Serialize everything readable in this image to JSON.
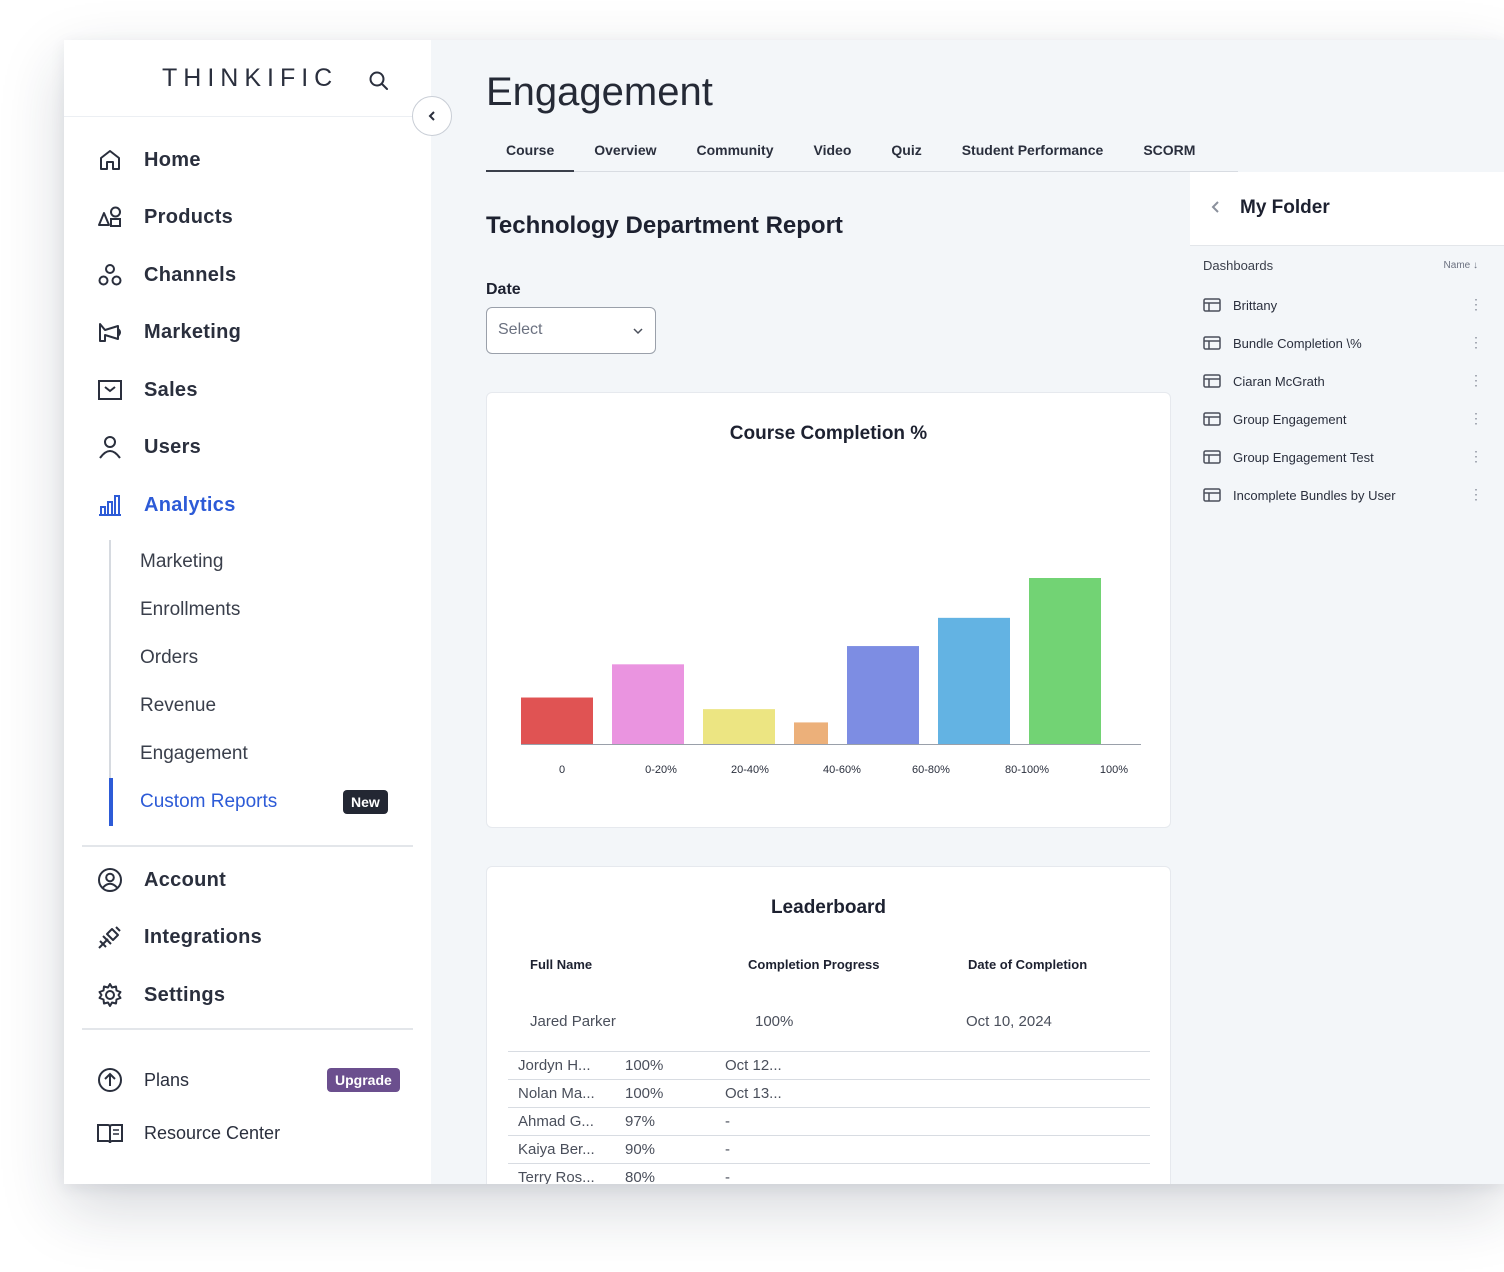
{
  "sidebar": {
    "logo": "THINKIFIC",
    "nav": [
      {
        "label": "Home",
        "icon": "home-icon"
      },
      {
        "label": "Products",
        "icon": "shapes-icon"
      },
      {
        "label": "Channels",
        "icon": "channels-icon"
      },
      {
        "label": "Marketing",
        "icon": "megaphone-icon"
      },
      {
        "label": "Sales",
        "icon": "inbox-icon"
      },
      {
        "label": "Users",
        "icon": "user-icon"
      },
      {
        "label": "Analytics",
        "icon": "bar-chart-icon"
      }
    ],
    "analytics_sub": [
      "Marketing",
      "Enrollments",
      "Orders",
      "Revenue",
      "Engagement",
      "Custom Reports"
    ],
    "new_badge": "New",
    "nav2": [
      {
        "label": "Account",
        "icon": "account-icon"
      },
      {
        "label": "Integrations",
        "icon": "plug-icon"
      },
      {
        "label": "Settings",
        "icon": "gear-icon"
      }
    ],
    "plans": "Plans",
    "upgrade_badge": "Upgrade",
    "resource_center": "Resource Center"
  },
  "main": {
    "title": "Engagement",
    "tabs": [
      "Course",
      "Overview",
      "Community",
      "Video",
      "Quiz",
      "Student Performance",
      "SCORM"
    ],
    "active_tab": "Course",
    "report_title": "Technology Department Report",
    "date_label": "Date",
    "date_select": "Select"
  },
  "chart_data": {
    "type": "bar",
    "title": "Course Completion %",
    "categories": [
      "0",
      "0-20%",
      "20-40%",
      "40-60%",
      "60-80%",
      "80-100%",
      "100%"
    ],
    "values": [
      28,
      48,
      21,
      13,
      59,
      76,
      100
    ],
    "colors": [
      "#e05353",
      "#ea94e0",
      "#ece582",
      "#ecb07a",
      "#7d8de3",
      "#63b3e3",
      "#72d374"
    ],
    "ylim": [
      0,
      100
    ],
    "grid": false,
    "legend": "none"
  },
  "leaderboard": {
    "title": "Leaderboard",
    "headers": [
      "Full Name",
      "Completion Progress",
      "Date of Completion"
    ],
    "first_row": [
      "Jared Parker",
      "100%",
      "Oct 10, 2024"
    ],
    "rows": [
      [
        "Jordyn H...",
        "100%",
        "Oct 12..."
      ],
      [
        "Nolan Ma...",
        "100%",
        "Oct 13..."
      ],
      [
        "Ahmad G...",
        "97%",
        "-"
      ],
      [
        "Kaiya Ber...",
        "90%",
        "-"
      ],
      [
        "Terry Ros...",
        "80%",
        "-"
      ]
    ]
  },
  "folder": {
    "title": "My Folder",
    "column": "Dashboards",
    "sort_label": "Name ↓",
    "items": [
      "Brittany",
      "Bundle Completion \\%",
      "Ciaran McGrath",
      "Group Engagement",
      "Group Engagement Test",
      "Incomplete Bundles by User"
    ]
  }
}
